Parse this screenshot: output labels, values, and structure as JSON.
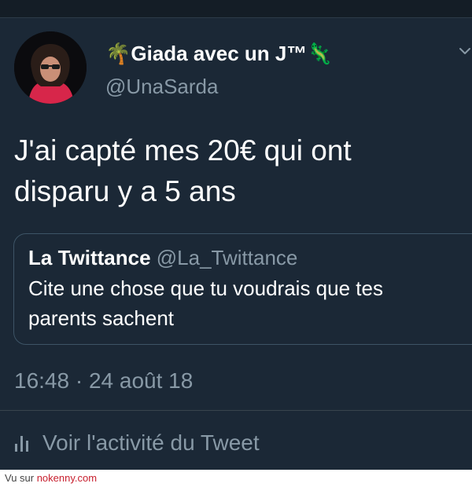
{
  "tweet": {
    "author_name": "Giada avec un J™",
    "name_prefix_emoji": "🌴",
    "name_suffix_emoji": "🦎",
    "author_handle": "@UnaSarda",
    "text_line1": "J'ai capté mes 20€ qui ont",
    "text_line2": "disparu y a 5 ans",
    "timestamp": "16:48 · 24 août 18",
    "activity_label": "Voir l'activité du Tweet"
  },
  "quoted_tweet": {
    "author_name": "La Twittance",
    "author_handle": "@La_Twittance",
    "text_line1": "Cite une chose que tu voudrais que tes",
    "text_line2": "parents sachent"
  },
  "footer": {
    "prefix": "Vu sur ",
    "site": "nokenny.com"
  },
  "colors": {
    "background": "#1b2836",
    "text_primary": "#ffffff",
    "text_secondary": "#8899a6",
    "quote_border": "#3d5466",
    "footer_link": "#c8202f"
  },
  "icons": {
    "menu": "chevron-down-icon",
    "activity": "bar-chart-icon"
  }
}
